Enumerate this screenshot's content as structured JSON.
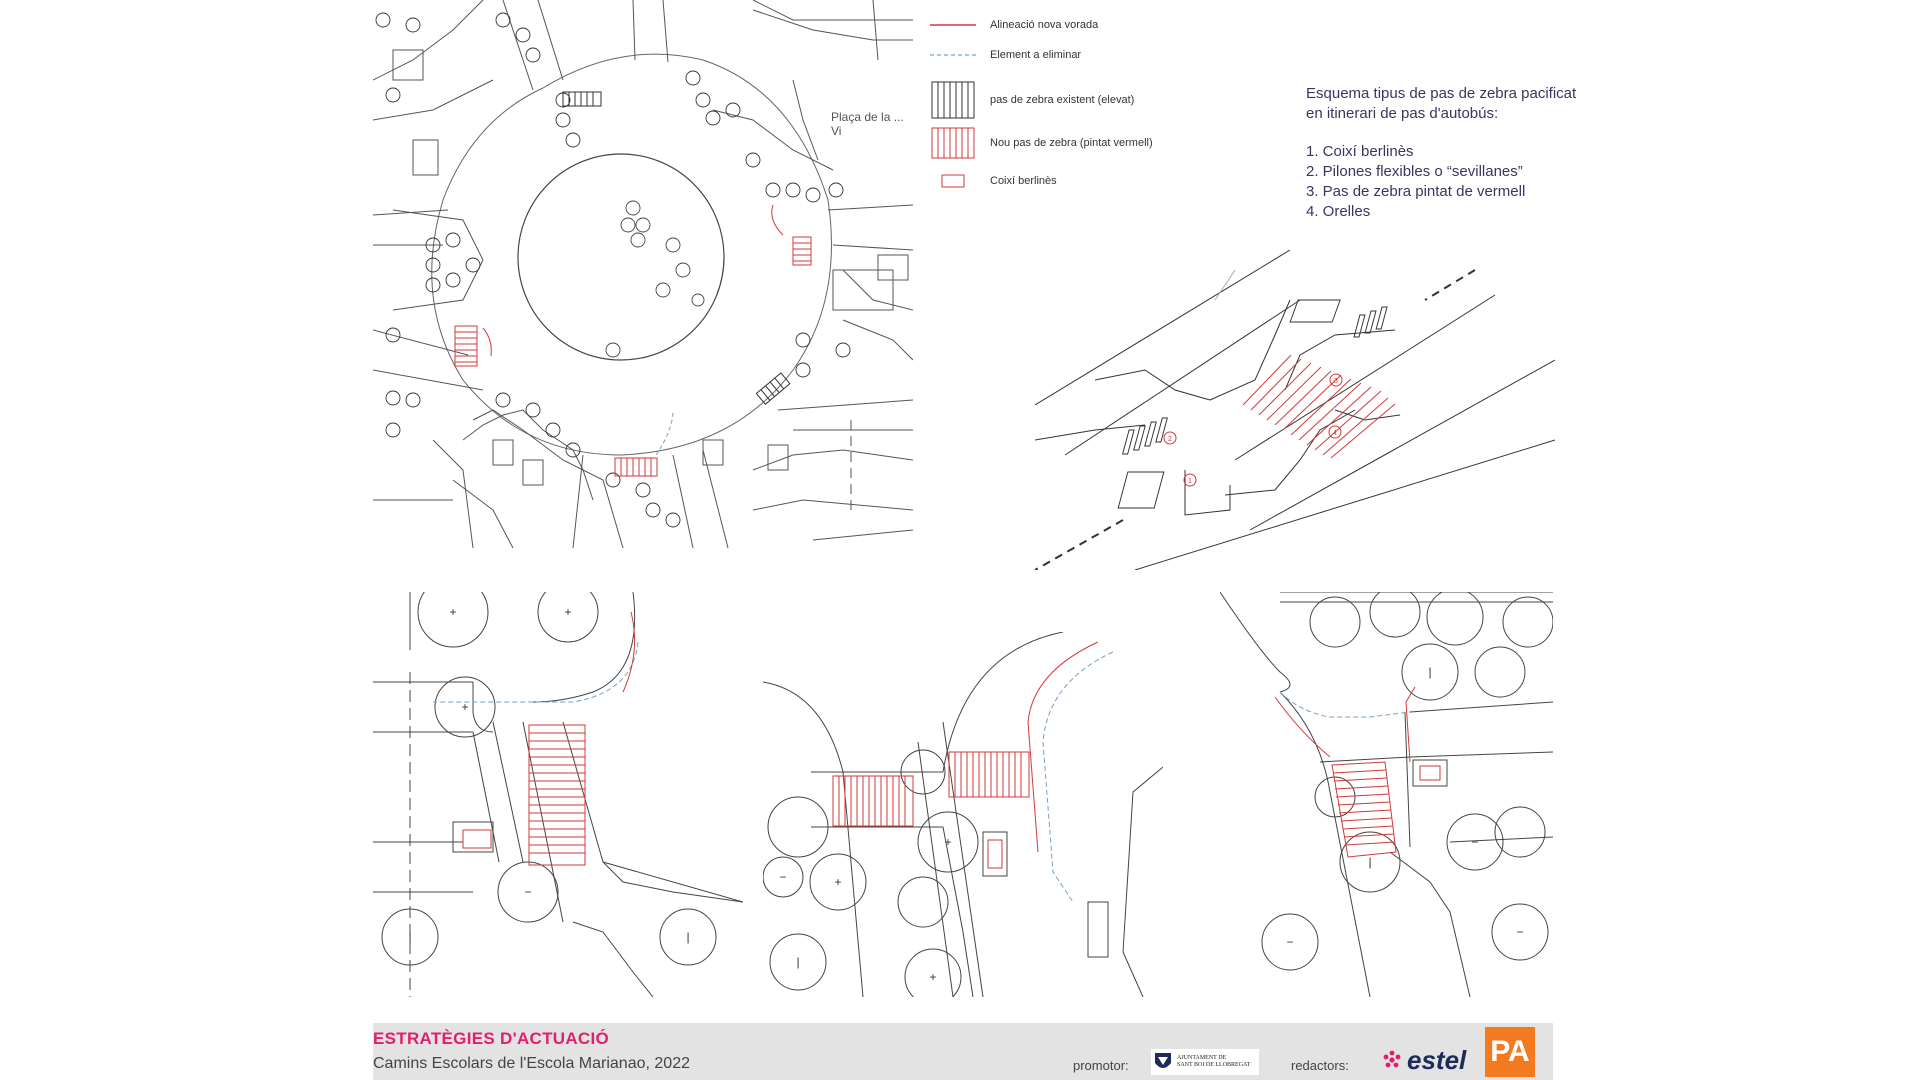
{
  "legend": {
    "items": [
      {
        "label": "Alineació nova vorada",
        "symbol": "red-line-icon"
      },
      {
        "label": "Element a eliminar",
        "symbol": "blue-dashed-line-icon"
      },
      {
        "label": "pas de zebra existent (elevat)",
        "symbol": "zebra-existing-icon"
      },
      {
        "label": "Nou pas de zebra (pintat vermell)",
        "symbol": "zebra-red-icon"
      },
      {
        "label": "Coixí berlinès",
        "symbol": "berlin-cushion-icon"
      }
    ]
  },
  "map": {
    "street_label": "Plaça de la ... Vi"
  },
  "schema": {
    "title_line1": "Esquema tipus de pas de zebra pacificat",
    "title_line2": "en itinerari de pas d'autobús:",
    "items": [
      "1. Coixí berlinès",
      "2. Pilones flexibles o “sevillanes”",
      "3. Pas de zebra pintat de vermell",
      "4. Orelles"
    ],
    "markers": [
      "1",
      "2",
      "3",
      "4"
    ]
  },
  "footer": {
    "title": "ESTRATÈGIES D'ACTUACIÓ",
    "subtitle": "Camins Escolars de l'Escola Marianao,  2022",
    "promotor_label": "promotor:",
    "redactors_label": "redactors:",
    "ajuntament_line1": "AJUNTAMENT DE",
    "ajuntament_line2": "SANT BOI DE LLOBREGAT",
    "estel_text": "estel",
    "pa_text": "PA"
  },
  "colors": {
    "accent_magenta": "#e0206e",
    "new_curb_red": "#d23a3a",
    "remove_blue": "#7aa0c0",
    "schema_text": "#3b3560",
    "pa_orange": "#f47a20",
    "footer_bg": "#e3e3e3"
  }
}
